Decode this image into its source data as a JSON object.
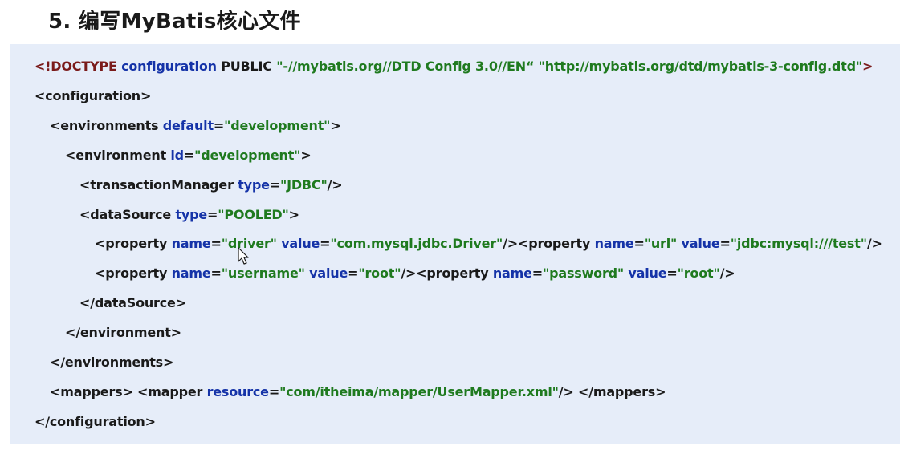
{
  "title": "5. 编写MyBatis核心文件",
  "colors": {
    "background": "#ffffff",
    "code_background": "#e6edf9",
    "tag": "#1a1a1a",
    "attribute": "#1533a8",
    "value": "#1f7a1f",
    "doctype": "#7a1a1a"
  },
  "code_lines": [
    [
      {
        "t": "<!DOCTYPE ",
        "k": "doctype"
      },
      {
        "t": "configuration ",
        "k": "attr"
      },
      {
        "t": "PUBLIC ",
        "k": "tag"
      },
      {
        "t": "\"-//mybatis.org//DTD Config 3.0//EN“ \"http://mybatis.org/dtd/mybatis-3-config.dtd\"",
        "k": "val"
      },
      {
        "t": ">",
        "k": "doctype"
      }
    ],
    [
      {
        "t": "<",
        "k": "punct"
      },
      {
        "t": "configuration",
        "k": "tag"
      },
      {
        "t": ">",
        "k": "punct"
      }
    ],
    [
      {
        "t": "<",
        "k": "punct"
      },
      {
        "t": "environments ",
        "k": "tag"
      },
      {
        "t": "default",
        "k": "attr"
      },
      {
        "t": "=",
        "k": "punct"
      },
      {
        "t": "\"development\"",
        "k": "val"
      },
      {
        "t": ">",
        "k": "punct"
      }
    ],
    [
      {
        "t": "<",
        "k": "punct"
      },
      {
        "t": "environment ",
        "k": "tag"
      },
      {
        "t": "id",
        "k": "attr"
      },
      {
        "t": "=",
        "k": "punct"
      },
      {
        "t": "\"development\"",
        "k": "val"
      },
      {
        "t": ">",
        "k": "punct"
      }
    ],
    [
      {
        "t": "<",
        "k": "punct"
      },
      {
        "t": "transactionManager ",
        "k": "tag"
      },
      {
        "t": "type",
        "k": "attr"
      },
      {
        "t": "=",
        "k": "punct"
      },
      {
        "t": "\"JDBC\"",
        "k": "val"
      },
      {
        "t": "/>",
        "k": "punct"
      }
    ],
    [
      {
        "t": "<",
        "k": "punct"
      },
      {
        "t": "dataSource ",
        "k": "tag"
      },
      {
        "t": "type",
        "k": "attr"
      },
      {
        "t": "=",
        "k": "punct"
      },
      {
        "t": "\"POOLED\"",
        "k": "val"
      },
      {
        "t": ">",
        "k": "punct"
      }
    ],
    [
      {
        "t": "<",
        "k": "punct"
      },
      {
        "t": "property ",
        "k": "tag"
      },
      {
        "t": "name",
        "k": "attr"
      },
      {
        "t": "=",
        "k": "punct"
      },
      {
        "t": "\"driver\" ",
        "k": "val"
      },
      {
        "t": "value",
        "k": "attr"
      },
      {
        "t": "=",
        "k": "punct"
      },
      {
        "t": "\"com.mysql.jdbc.Driver\"",
        "k": "val"
      },
      {
        "t": "/><",
        "k": "punct"
      },
      {
        "t": "property ",
        "k": "tag"
      },
      {
        "t": "name",
        "k": "attr"
      },
      {
        "t": "=",
        "k": "punct"
      },
      {
        "t": "\"url\" ",
        "k": "val"
      },
      {
        "t": "value",
        "k": "attr"
      },
      {
        "t": "=",
        "k": "punct"
      },
      {
        "t": "\"jdbc:mysql:///test\"",
        "k": "val"
      },
      {
        "t": "/>",
        "k": "punct"
      }
    ],
    [
      {
        "t": "<",
        "k": "punct"
      },
      {
        "t": "property ",
        "k": "tag"
      },
      {
        "t": "name",
        "k": "attr"
      },
      {
        "t": "=",
        "k": "punct"
      },
      {
        "t": "\"username\" ",
        "k": "val"
      },
      {
        "t": "value",
        "k": "attr"
      },
      {
        "t": "=",
        "k": "punct"
      },
      {
        "t": "\"root\"",
        "k": "val"
      },
      {
        "t": "/><",
        "k": "punct"
      },
      {
        "t": "property ",
        "k": "tag"
      },
      {
        "t": "name",
        "k": "attr"
      },
      {
        "t": "=",
        "k": "punct"
      },
      {
        "t": "\"password\" ",
        "k": "val"
      },
      {
        "t": "value",
        "k": "attr"
      },
      {
        "t": "=",
        "k": "punct"
      },
      {
        "t": "\"root\"",
        "k": "val"
      },
      {
        "t": "/>",
        "k": "punct"
      }
    ],
    [
      {
        "t": "</",
        "k": "punct"
      },
      {
        "t": "dataSource",
        "k": "tag"
      },
      {
        "t": ">",
        "k": "punct"
      }
    ],
    [
      {
        "t": "</",
        "k": "punct"
      },
      {
        "t": "environment",
        "k": "tag"
      },
      {
        "t": ">",
        "k": "punct"
      }
    ],
    [
      {
        "t": "</",
        "k": "punct"
      },
      {
        "t": "environments",
        "k": "tag"
      },
      {
        "t": ">",
        "k": "punct"
      }
    ],
    [
      {
        "t": "<",
        "k": "punct"
      },
      {
        "t": "mappers",
        "k": "tag"
      },
      {
        "t": "> <",
        "k": "punct"
      },
      {
        "t": "mapper ",
        "k": "tag"
      },
      {
        "t": "resource",
        "k": "attr"
      },
      {
        "t": "=",
        "k": "punct"
      },
      {
        "t": "\"com/itheima/mapper/UserMapper.xml\"",
        "k": "val"
      },
      {
        "t": "/> </",
        "k": "punct"
      },
      {
        "t": "mappers",
        "k": "tag"
      },
      {
        "t": ">",
        "k": "punct"
      }
    ],
    [
      {
        "t": "</",
        "k": "punct"
      },
      {
        "t": "configuration",
        "k": "tag"
      },
      {
        "t": ">",
        "k": "punct"
      }
    ]
  ],
  "cursor_icon": "mouse-pointer-icon"
}
